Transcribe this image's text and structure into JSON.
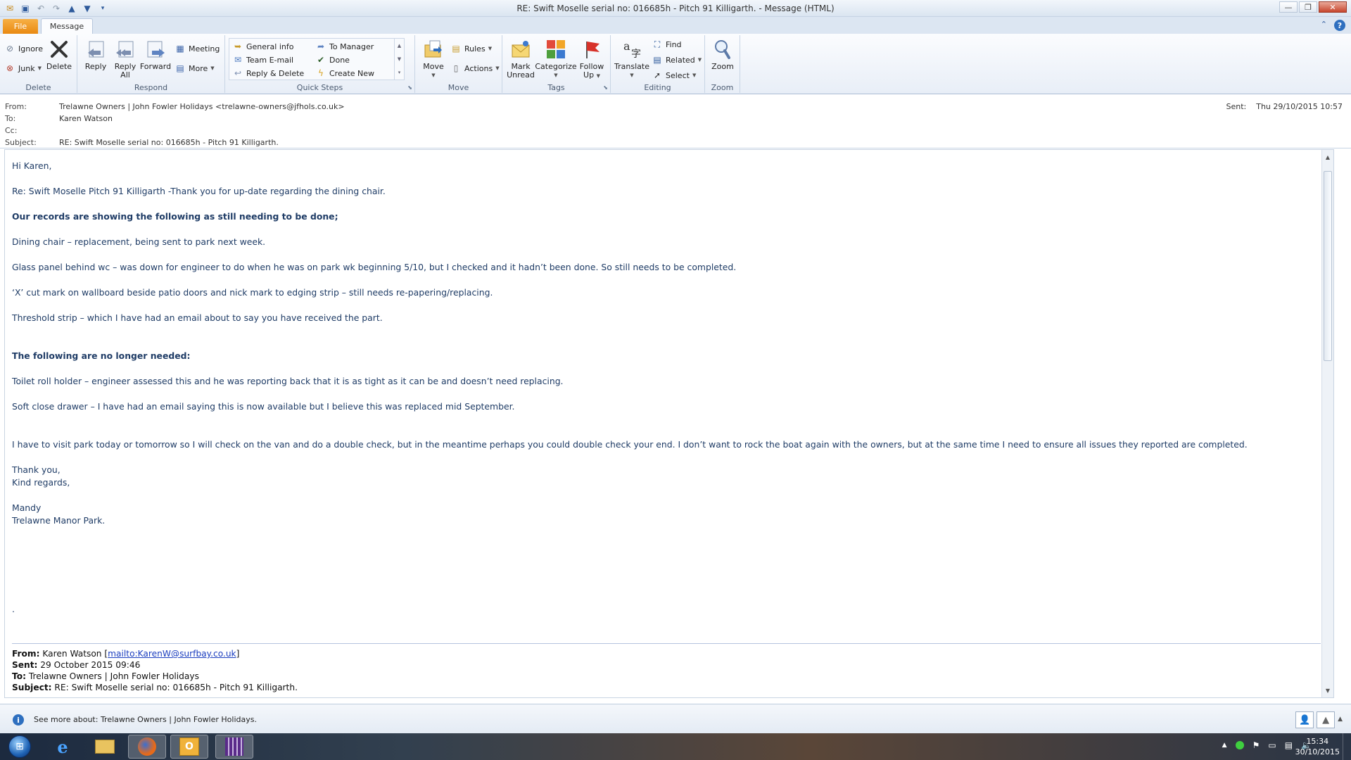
{
  "window": {
    "title": "RE: Swift Moselle serial no: 016685h - Pitch 91 Killigarth.  -  Message (HTML)"
  },
  "tabs": {
    "file": "File",
    "message": "Message"
  },
  "ribbon": {
    "delete_group": {
      "label": "Delete",
      "ignore": "Ignore",
      "junk": "Junk",
      "delete": "Delete"
    },
    "respond_group": {
      "label": "Respond",
      "reply": "Reply",
      "reply_all_1": "Reply",
      "reply_all_2": "All",
      "forward": "Forward",
      "meeting": "Meeting",
      "more": "More"
    },
    "quicksteps_group": {
      "label": "Quick Steps",
      "items": [
        "General info",
        "Team E-mail",
        "Reply & Delete",
        "To Manager",
        "Done",
        "Create New"
      ]
    },
    "move_group": {
      "label": "Move",
      "move": "Move",
      "rules": "Rules",
      "actions": "Actions"
    },
    "tags_group": {
      "label": "Tags",
      "mark_unread_1": "Mark",
      "mark_unread_2": "Unread",
      "categorize": "Categorize",
      "follow_up_1": "Follow",
      "follow_up_2": "Up"
    },
    "editing_group": {
      "label": "Editing",
      "translate": "Translate",
      "find": "Find",
      "related": "Related",
      "select": "Select"
    },
    "zoom_group": {
      "label": "Zoom",
      "zoom": "Zoom"
    }
  },
  "header": {
    "from_label": "From:",
    "from_value": "Trelawne Owners  |  John Fowler Holidays <trelawne-owners@jfhols.co.uk>",
    "to_label": "To:",
    "to_value": "Karen Watson",
    "cc_label": "Cc:",
    "cc_value": "",
    "subject_label": "Subject:",
    "subject_value": "RE: Swift Moselle serial no: 016685h - Pitch 91 Killigarth.",
    "sent_label": "Sent:",
    "sent_value": "Thu 29/10/2015 10:57"
  },
  "body": {
    "greeting": "Hi Karen,",
    "intro": "Re: Swift Moselle Pitch 91 Killigarth -Thank you for up-date regarding the dining chair.",
    "heading1": "Our records are showing the following as still needing to be done;",
    "item1": "Dining chair – replacement, being sent to park next week.",
    "item2": "Glass panel behind wc – was down for engineer to do when he was on park wk beginning 5/10, but I checked and it hadn’t been done. So still needs to be completed.",
    "item3": "‘X’ cut mark on wallboard beside patio doors and nick mark to edging strip – still needs re-papering/replacing.",
    "item4": "Threshold strip – which I have had an email about to say you have received the part.",
    "heading2": "The following are no longer needed:",
    "item5": "Toilet roll holder – engineer assessed this and he was reporting back that it is as tight as it can be and doesn’t need replacing.",
    "item6": "Soft close drawer – I have had an email saying this is now available but I believe this was replaced mid September.",
    "para": "I have to visit park today or tomorrow so I will check on the van and do a double check, but in the meantime perhaps you could double check your end.  I don’t want to rock the boat again with the owners, but at the same time I need to ensure all issues they reported are completed.",
    "thanks": "Thank you,",
    "regards": "Kind regards,",
    "name": "Mandy",
    "org": "Trelawne Manor Park.",
    "dot": "."
  },
  "quoted": {
    "from_label": "From:",
    "from_name": "Karen Watson",
    "from_link": "mailto:KarenW@surfbay.co.uk",
    "sent_label": "Sent:",
    "sent_value": "29 October 2015 09:46",
    "to_label": "To:",
    "to_value": "Trelawne Owners | John Fowler Holidays",
    "subject_label": "Subject:",
    "subject_value": "RE: Swift Moselle serial no: 016685h - Pitch 91 Killigarth."
  },
  "people_pane": {
    "text": "See more about: Trelawne Owners  |  John Fowler Holidays."
  },
  "taskbar": {
    "time": "15:34",
    "date": "30/10/2015"
  }
}
